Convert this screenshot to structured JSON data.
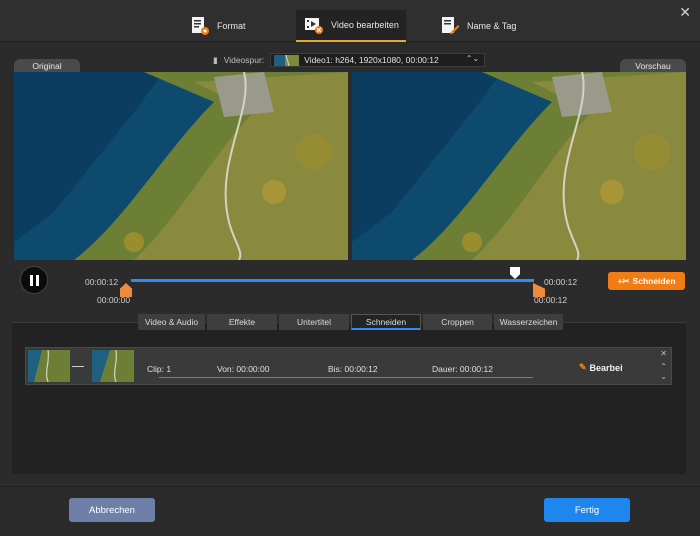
{
  "tabs": [
    {
      "label": "Format",
      "icon": "format-settings-icon"
    },
    {
      "label": "Video bearbeiten",
      "icon": "video-edit-icon",
      "active": true
    },
    {
      "label": "Name & Tag",
      "icon": "edit-tag-icon"
    }
  ],
  "preview": {
    "original_label": "Original",
    "preview_label": "Vorschau",
    "track_label": "Videospur:",
    "track_value": "Video1: h264, 1920x1080, 00:00:12"
  },
  "timeline": {
    "start_top": "00:00:12",
    "start_bottom": "00:00:00",
    "end_top": "00:00:12",
    "end_bottom": "00:00:12",
    "cut_button": "Schneiden"
  },
  "subtabs": [
    "Video & Audio",
    "Effekte",
    "Untertitel",
    "Schneiden",
    "Croppen",
    "Wasserzeichen"
  ],
  "clip": {
    "clip": "Clip: 1",
    "from": "Von:  00:00:00",
    "to": "Bis:  00:00:12",
    "duration": "Dauer: 00:00:12",
    "edit": "Bearbeiten"
  },
  "footer": {
    "cancel": "Abbrechen",
    "done": "Fertig"
  },
  "colors": {
    "accent": "#f07d14",
    "primary": "#1f86ee",
    "cancel": "#6e7fa8"
  }
}
